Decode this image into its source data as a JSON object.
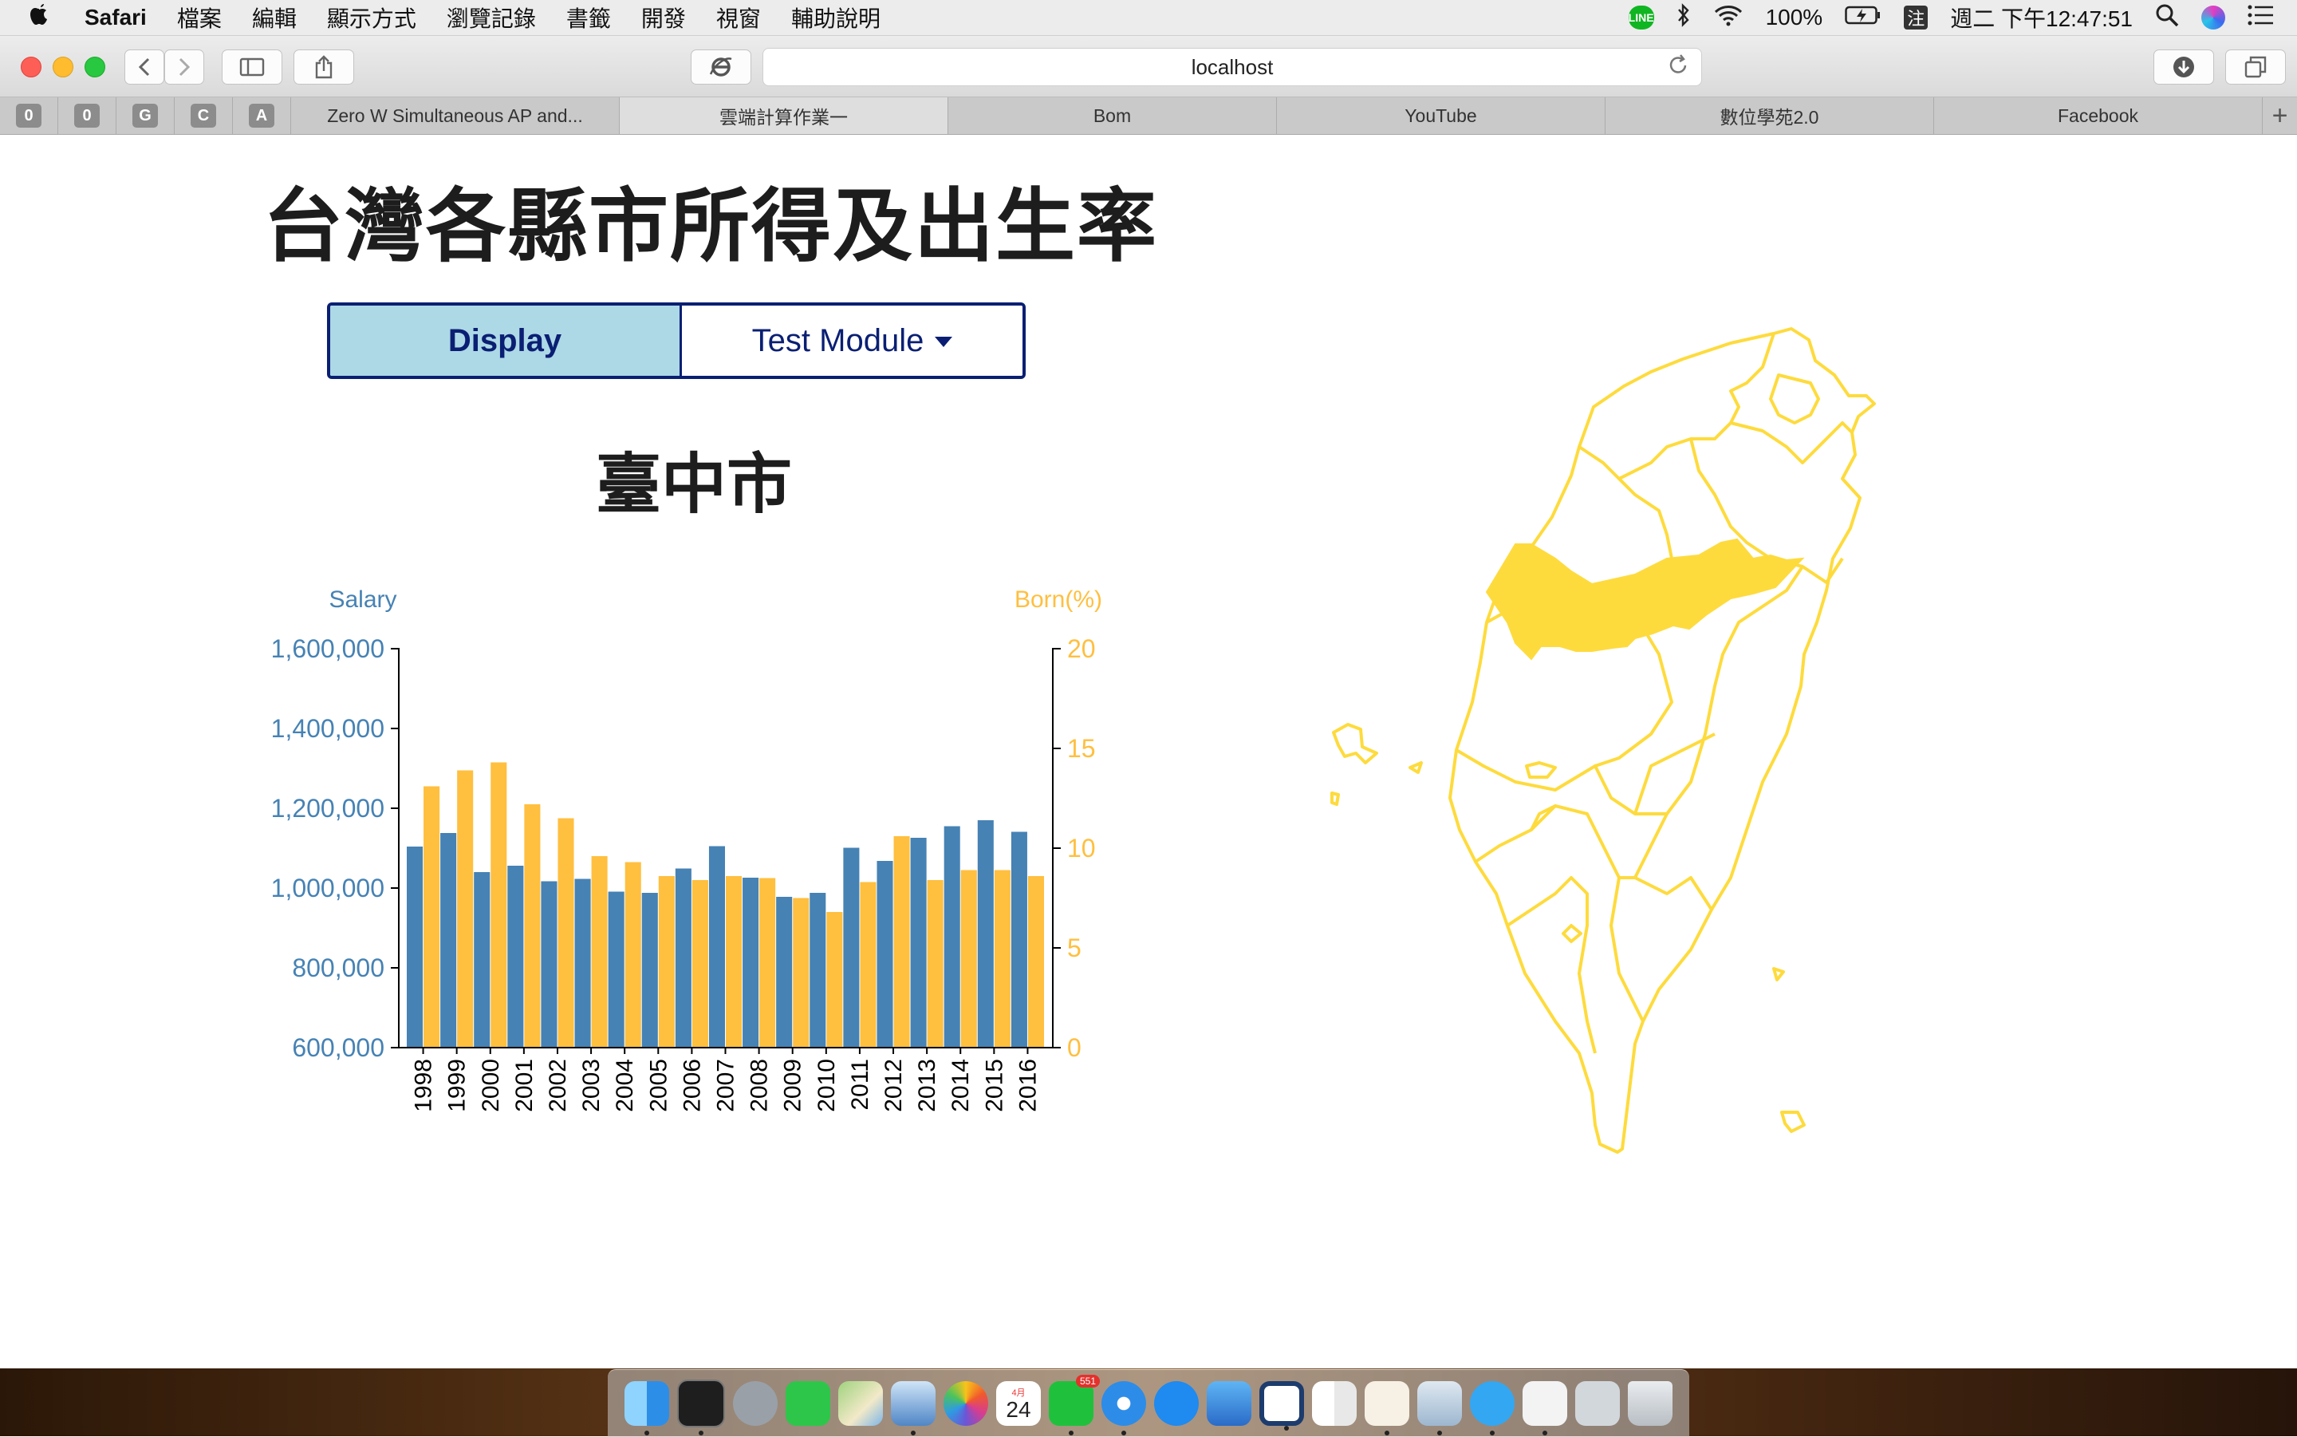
{
  "menubar": {
    "app_name": "Safari",
    "menus": [
      "檔案",
      "編輯",
      "顯示方式",
      "瀏覽記錄",
      "書籤",
      "開發",
      "視窗",
      "輔助說明"
    ],
    "line_badge": "LINE",
    "battery": "100%",
    "input_method": "注",
    "clock": "週二 下午12:47:51"
  },
  "browser": {
    "url": "localhost",
    "pinned_tabs": [
      "0",
      "0",
      "G",
      "C",
      "A"
    ],
    "tabs": [
      {
        "label": "Zero W Simultaneous AP and...",
        "active": false
      },
      {
        "label": "雲端計算作業一",
        "active": true
      },
      {
        "label": "Bom",
        "active": false
      },
      {
        "label": "YouTube",
        "active": false
      },
      {
        "label": "數位學苑2.0",
        "active": false
      },
      {
        "label": "Facebook",
        "active": false
      }
    ],
    "new_tab": "+"
  },
  "page": {
    "title": "台灣各縣市所得及出生率",
    "display_button": "Display",
    "test_module_button": "Test Module",
    "city": "臺中市"
  },
  "colors": {
    "salary": "#4682b4",
    "born": "#ffbf3f",
    "map_line": "#fedb3d",
    "map_selected": "#fedb3d",
    "button_border": "#0a1f73",
    "display_bg": "#add8e6"
  },
  "chart_data": {
    "type": "bar",
    "categories": [
      "1998",
      "1999",
      "2000",
      "2001",
      "2002",
      "2003",
      "2004",
      "2005",
      "2006",
      "2007",
      "2008",
      "2009",
      "2010",
      "2011",
      "2012",
      "2013",
      "2014",
      "2015",
      "2016"
    ],
    "series": [
      {
        "name": "Salary",
        "axis": "left",
        "values": [
          1104000,
          1138000,
          1040000,
          1056000,
          1017000,
          1023000,
          991000,
          988000,
          1049000,
          1105000,
          1026000,
          978000,
          988000,
          1101000,
          1068000,
          1126000,
          1155000,
          1170000,
          1141000
        ]
      },
      {
        "name": "Born(%)",
        "axis": "right",
        "values": [
          13.1,
          13.9,
          14.3,
          12.2,
          11.5,
          9.6,
          9.3,
          8.6,
          8.4,
          8.6,
          8.5,
          7.5,
          6.8,
          8.3,
          10.6,
          8.4,
          8.9,
          8.9,
          8.6
        ]
      }
    ],
    "ylabel_left": "Salary",
    "ylabel_right": "Born(%)",
    "ylim_left": [
      600000,
      1600000
    ],
    "ylim_right": [
      0,
      20
    ],
    "yticks_left": [
      "600,000",
      "800,000",
      "1,000,000",
      "1,200,000",
      "1,400,000",
      "1,600,000"
    ],
    "yticks_right": [
      "0",
      "5",
      "10",
      "15",
      "20"
    ],
    "grid": false
  },
  "map": {
    "selected_region": "臺中市"
  },
  "dock": {
    "icons": [
      "finder-icon",
      "terminal-icon",
      "launchpad-icon",
      "facetime-icon",
      "maps-icon",
      "preview-icon",
      "photos-icon",
      "calendar-icon",
      "line-icon",
      "safari-icon",
      "app-store-icon",
      "xcode-icon",
      "sourcetree-icon",
      "numbers-icon",
      "pages-icon",
      "keynote-icon",
      "messages-icon",
      "textedit-icon",
      "downloads-icon",
      "trash-icon"
    ],
    "calendar_day": "24",
    "calendar_month": "4月",
    "line_badge_count": "551"
  }
}
